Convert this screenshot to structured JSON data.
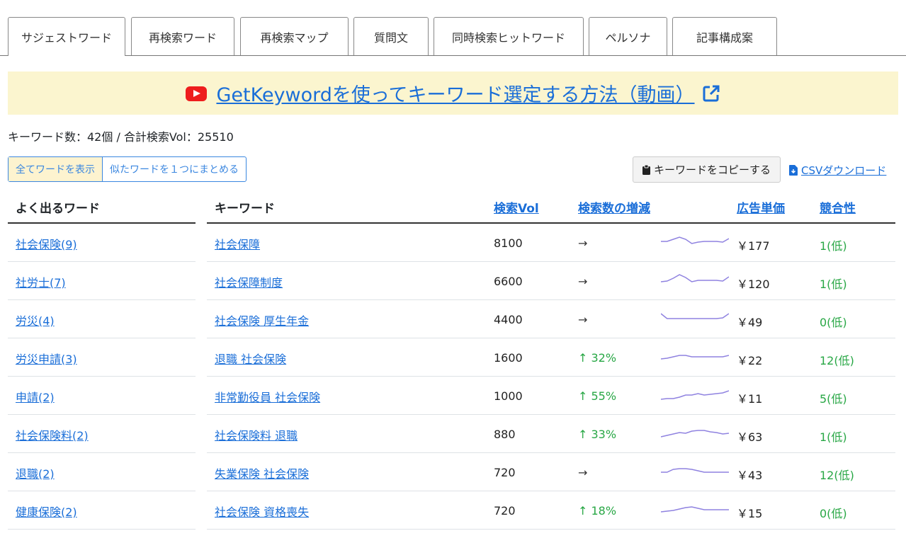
{
  "tabs": [
    {
      "label": "サジェストワード",
      "active": true
    },
    {
      "label": "再検索ワード",
      "active": false
    },
    {
      "label": "再検索マップ",
      "active": false
    },
    {
      "label": "質問文",
      "active": false
    },
    {
      "label": "同時検索ヒットワード",
      "active": false
    },
    {
      "label": "ペルソナ",
      "active": false
    },
    {
      "label": "記事構成案",
      "active": false
    }
  ],
  "banner": {
    "link_text": "GetKeywordを使ってキーワード選定する方法（動画）",
    "icon": "youtube-icon",
    "ext_icon": "external-link-icon"
  },
  "summary": "キーワード数：42個 / 合計検索Vol：25510",
  "toggle": {
    "show_all": "全てワードを表示",
    "group_similar": "似たワードを１つにまとめる"
  },
  "toolbar": {
    "copy_label": "キーワードをコピーする",
    "csv_label": "CSVダウンロード"
  },
  "frequent_words": {
    "header": "よく出るワード",
    "items": [
      "社会保険(9)",
      "社労士(7)",
      "労災(4)",
      "労災申請(3)",
      "申請(2)",
      "社会保険料(2)",
      "退職(2)",
      "健康保険(2)"
    ]
  },
  "table": {
    "headers": {
      "keyword": "キーワード",
      "volume": "検索Vol",
      "trend": "検索数の増減",
      "cpc": "広告単価",
      "competition": "競合性"
    },
    "rows": [
      {
        "keyword": "社会保障",
        "volume": "8100",
        "trend": "→",
        "trend_type": "flat",
        "cpc": "￥177",
        "competition": "1(低)",
        "spark": [
          10,
          10,
          7,
          4,
          7,
          13,
          11,
          10,
          10,
          10,
          11,
          6
        ]
      },
      {
        "keyword": "社会保障制度",
        "volume": "6600",
        "trend": "→",
        "trend_type": "flat",
        "cpc": "￥120",
        "competition": "1(低)",
        "spark": [
          13,
          12,
          8,
          3,
          7,
          13,
          11,
          11,
          11,
          11,
          12,
          6
        ]
      },
      {
        "keyword": "社会保険 厚生年金",
        "volume": "4400",
        "trend": "→",
        "trend_type": "flat",
        "cpc": "￥49",
        "competition": "0(低)",
        "spark": [
          4,
          11,
          11,
          11,
          11,
          11,
          11,
          11,
          11,
          11,
          10,
          4
        ]
      },
      {
        "keyword": "退職 社会保険",
        "volume": "1600",
        "trend": "↑ 32%",
        "trend_type": "up",
        "cpc": "￥22",
        "competition": "12(低)",
        "spark": [
          14,
          13,
          11,
          9,
          9,
          11,
          11,
          11,
          11,
          11,
          11,
          9
        ]
      },
      {
        "keyword": "非常勤役員 社会保険",
        "volume": "1000",
        "trend": "↑ 55%",
        "trend_type": "up",
        "cpc": "￥11",
        "competition": "5(低)",
        "spark": [
          17,
          16,
          16,
          14,
          11,
          11,
          9,
          11,
          10,
          9,
          8,
          5
        ]
      },
      {
        "keyword": "社会保険料 退職",
        "volume": "880",
        "trend": "↑ 33%",
        "trend_type": "up",
        "cpc": "￥63",
        "competition": "1(低)",
        "spark": [
          16,
          14,
          12,
          10,
          11,
          8,
          7,
          7,
          9,
          10,
          12,
          11
        ]
      },
      {
        "keyword": "失業保険 社会保険",
        "volume": "720",
        "trend": "→",
        "trend_type": "flat",
        "cpc": "￥43",
        "competition": "12(低)",
        "spark": [
          12,
          12,
          8,
          7,
          7,
          8,
          10,
          12,
          12,
          12,
          12,
          12
        ]
      },
      {
        "keyword": "社会保険 資格喪失",
        "volume": "720",
        "trend": "↑ 18%",
        "trend_type": "up",
        "cpc": "￥15",
        "competition": "0(低)",
        "spark": [
          14,
          13,
          12,
          10,
          8,
          7,
          9,
          11,
          11,
          11,
          11,
          11
        ]
      }
    ]
  },
  "colors": {
    "link": "#1a6ed8",
    "spark": "#8f82e0",
    "up": "#28a745",
    "banner_bg": "#fbf5cf"
  }
}
